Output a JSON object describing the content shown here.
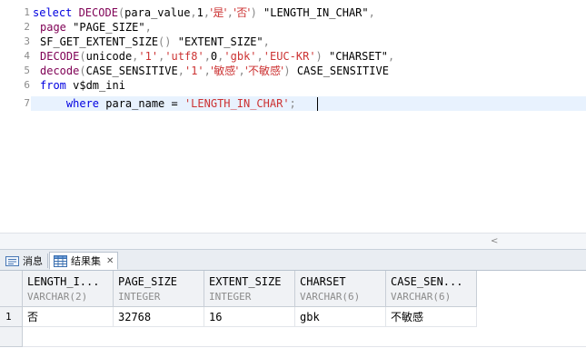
{
  "editor": {
    "line_numbers": [
      "1",
      "2",
      "3",
      "4",
      "5",
      "6",
      "7"
    ],
    "lines": [
      [
        {
          "t": "select ",
          "c": "kw"
        },
        {
          "t": "DECODE",
          "c": "fn"
        },
        {
          "t": "(",
          "c": "pun"
        },
        {
          "t": "para_value",
          "c": "pl"
        },
        {
          "t": ",",
          "c": "pun"
        },
        {
          "t": "1",
          "c": "pl"
        },
        {
          "t": ",",
          "c": "pun"
        },
        {
          "t": "'是'",
          "c": "str"
        },
        {
          "t": ",",
          "c": "pun"
        },
        {
          "t": "'否'",
          "c": "str"
        },
        {
          "t": ") ",
          "c": "pun"
        },
        {
          "t": "\"LENGTH_IN_CHAR\"",
          "c": "pl"
        },
        {
          "t": ",",
          "c": "pun"
        }
      ],
      [
        {
          "t": "page ",
          "c": "fn"
        },
        {
          "t": "\"PAGE_SIZE\"",
          "c": "pl"
        },
        {
          "t": ",",
          "c": "pun"
        }
      ],
      [
        {
          "t": "SF_GET_EXTENT_SIZE",
          "c": "pl"
        },
        {
          "t": "() ",
          "c": "pun"
        },
        {
          "t": "\"EXTENT_SIZE\"",
          "c": "pl"
        },
        {
          "t": ",",
          "c": "pun"
        }
      ],
      [
        {
          "t": "DECODE",
          "c": "fn"
        },
        {
          "t": "(",
          "c": "pun"
        },
        {
          "t": "unicode",
          "c": "pl"
        },
        {
          "t": ",",
          "c": "pun"
        },
        {
          "t": "'1'",
          "c": "str"
        },
        {
          "t": ",",
          "c": "pun"
        },
        {
          "t": "'utf8'",
          "c": "str"
        },
        {
          "t": ",",
          "c": "pun"
        },
        {
          "t": "0",
          "c": "pl"
        },
        {
          "t": ",",
          "c": "pun"
        },
        {
          "t": "'gbk'",
          "c": "str"
        },
        {
          "t": ",",
          "c": "pun"
        },
        {
          "t": "'EUC-KR'",
          "c": "str"
        },
        {
          "t": ") ",
          "c": "pun"
        },
        {
          "t": "\"CHARSET\"",
          "c": "pl"
        },
        {
          "t": ",",
          "c": "pun"
        }
      ],
      [
        {
          "t": "decode",
          "c": "fn"
        },
        {
          "t": "(",
          "c": "pun"
        },
        {
          "t": "CASE_SENSITIVE",
          "c": "pl"
        },
        {
          "t": ",",
          "c": "pun"
        },
        {
          "t": "'1'",
          "c": "str"
        },
        {
          "t": ",",
          "c": "pun"
        },
        {
          "t": "'敏感'",
          "c": "str"
        },
        {
          "t": ",",
          "c": "pun"
        },
        {
          "t": "'不敏感'",
          "c": "str"
        },
        {
          "t": ") ",
          "c": "pun"
        },
        {
          "t": "CASE_SENSITIVE",
          "c": "pl"
        }
      ],
      [
        {
          "t": "from ",
          "c": "kw"
        },
        {
          "t": "v$dm_ini",
          "c": "pl"
        }
      ],
      [
        {
          "t": "    where ",
          "c": "kw"
        },
        {
          "t": "para_name = ",
          "c": "pl"
        },
        {
          "t": "'LENGTH_IN_CHAR'",
          "c": "str"
        },
        {
          "t": ";",
          "c": "pun"
        }
      ]
    ],
    "scroll_arrow": "<"
  },
  "tabs": {
    "messages_label": "消息",
    "results_label": "结果集",
    "results_close": "✕"
  },
  "grid": {
    "columns": [
      {
        "name": "LENGTH_I...",
        "type": "VARCHAR(2)"
      },
      {
        "name": "PAGE_SIZE",
        "type": "INTEGER"
      },
      {
        "name": "EXTENT_SIZE",
        "type": "INTEGER"
      },
      {
        "name": "CHARSET",
        "type": "VARCHAR(6)"
      },
      {
        "name": "CASE_SEN...",
        "type": "VARCHAR(6)"
      }
    ],
    "rows": [
      {
        "num": "1",
        "cells": [
          "否",
          "32768",
          "16",
          "gbk",
          "不敏感"
        ]
      }
    ]
  }
}
